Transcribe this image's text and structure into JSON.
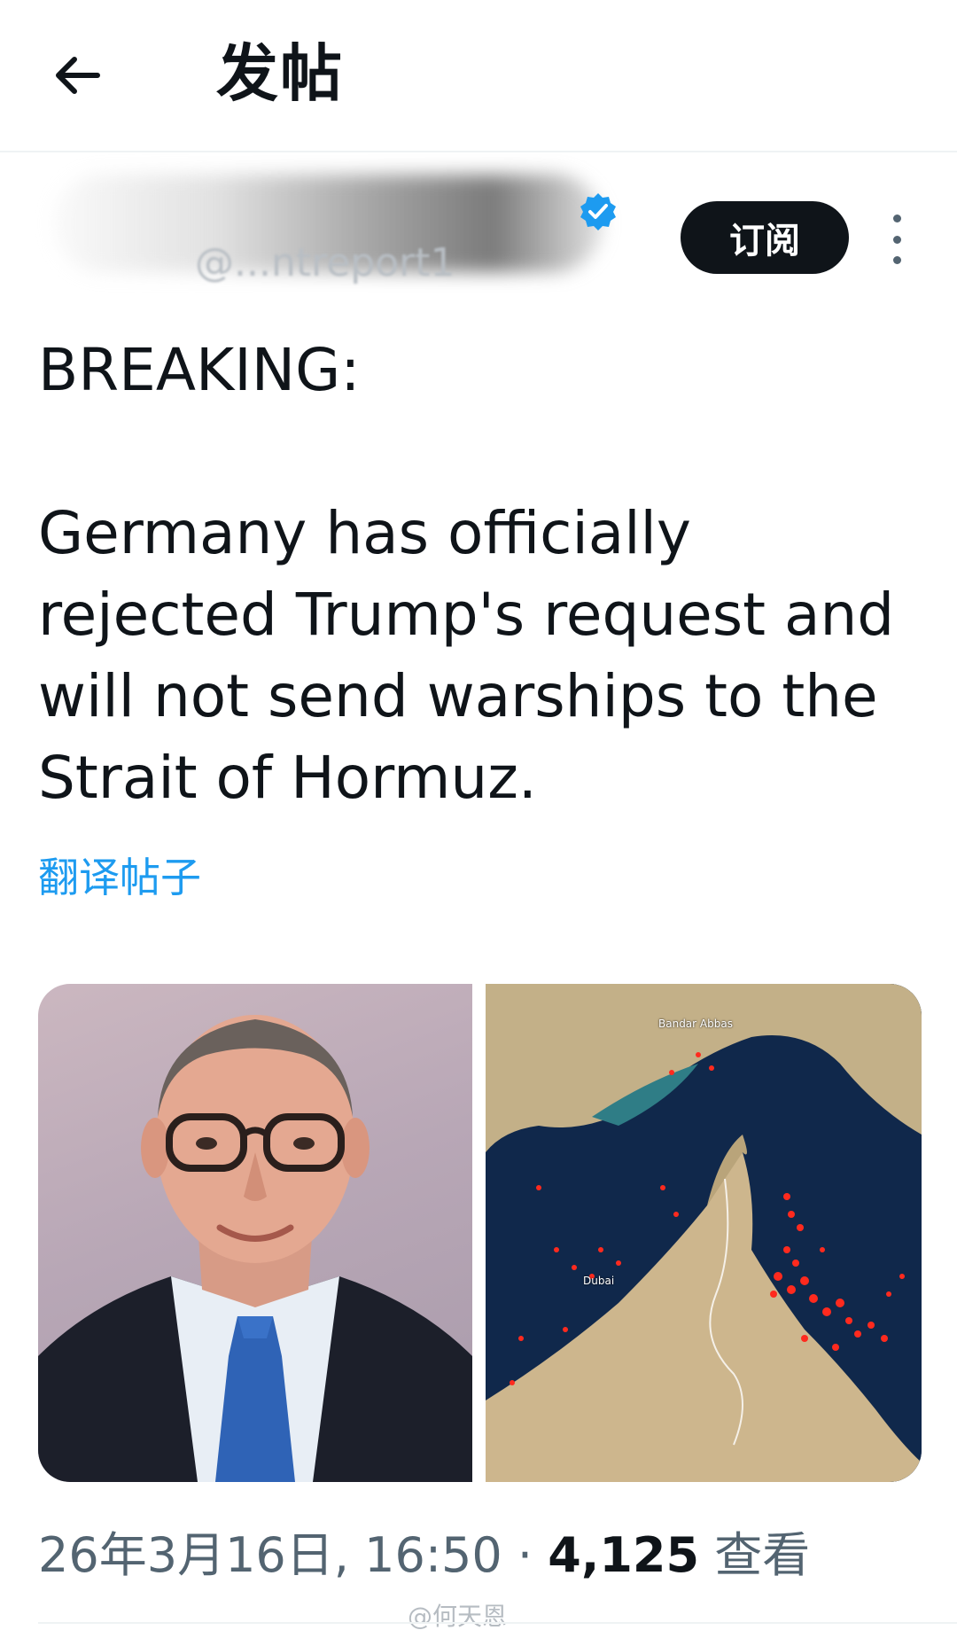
{
  "header": {
    "back_icon": "arrow-left-icon",
    "title": "发帖"
  },
  "author": {
    "handle": "@...ntreport1",
    "verified_icon": "verified-badge-icon",
    "subscribe_label": "订阅",
    "more_icon": "more-vertical-icon"
  },
  "post": {
    "text": "BREAKING:\n\nGermany has officially rejected Trump's request and will not send warships to the Strait of Hormuz.",
    "translate_label": "翻译帖子"
  },
  "media": {
    "map_labels": {
      "bandar_abbas": "Bandar Abbas",
      "dubai": "Dubai"
    }
  },
  "meta": {
    "timestamp": "26年3月16日, 16:50",
    "separator": "·",
    "views_count": "4,125",
    "views_label": "查看"
  },
  "watermark": "@何天恩",
  "colors": {
    "accent": "#1d9bf0",
    "text_primary": "#0f1419",
    "text_secondary": "#536471",
    "button_dark": "#0f1419"
  }
}
